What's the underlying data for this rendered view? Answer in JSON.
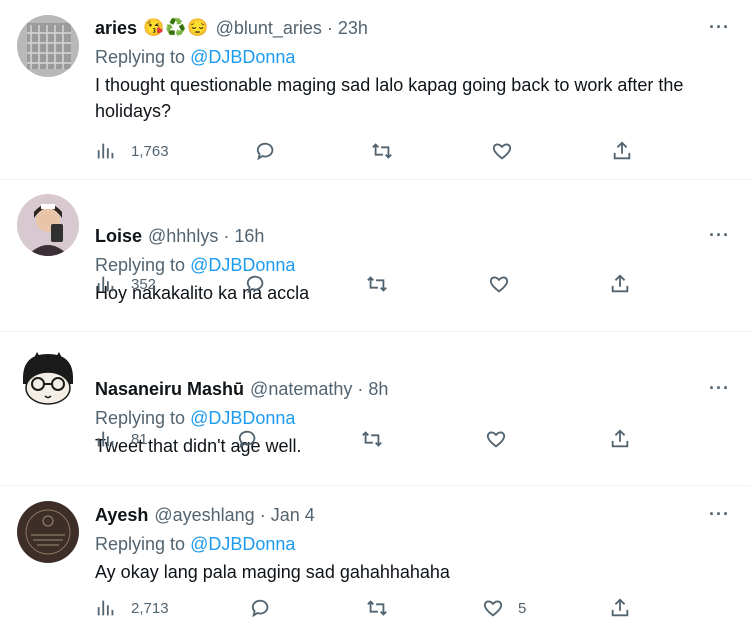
{
  "tweets": [
    {
      "name": "aries",
      "emoji": "😘♻️😔",
      "handle": "@blunt_aries",
      "time": "23h",
      "replying_prefix": "Replying to",
      "replying_to": "@DJBDonna",
      "text": "I thought questionable maging sad lalo kapag going back to work after the holidays?",
      "views": "1,763",
      "likes": ""
    },
    {
      "name": "Loise",
      "emoji": "",
      "handle": "@hhhlys",
      "time": "16h",
      "replying_prefix": "Replying to",
      "replying_to": "@DJBDonna",
      "text": "Hoy nakakalito ka na accla",
      "views": "352",
      "likes": ""
    },
    {
      "name": "Nasaneiru Mashū",
      "emoji": "",
      "handle": "@natemathy",
      "time": "8h",
      "replying_prefix": "Replying to",
      "replying_to": "@DJBDonna",
      "text": "Tweet that didn't age well.",
      "views": "81",
      "likes": ""
    },
    {
      "name": "Ayesh",
      "emoji": "",
      "handle": "@ayeshlang",
      "time": "Jan 4",
      "replying_prefix": "Replying to",
      "replying_to": "@DJBDonna",
      "text": "Ay okay lang pala maging sad gahahhahaha",
      "views": "2,713",
      "likes": "5"
    }
  ],
  "ui": {
    "more_label": "···",
    "separator": "·"
  },
  "colors": {
    "text": "#0f1419",
    "muted": "#536471",
    "link": "#1d9bf0",
    "border": "#eff3f4"
  },
  "icons": [
    "views-icon",
    "reply-icon",
    "retweet-icon",
    "like-icon",
    "share-icon",
    "more-icon"
  ]
}
